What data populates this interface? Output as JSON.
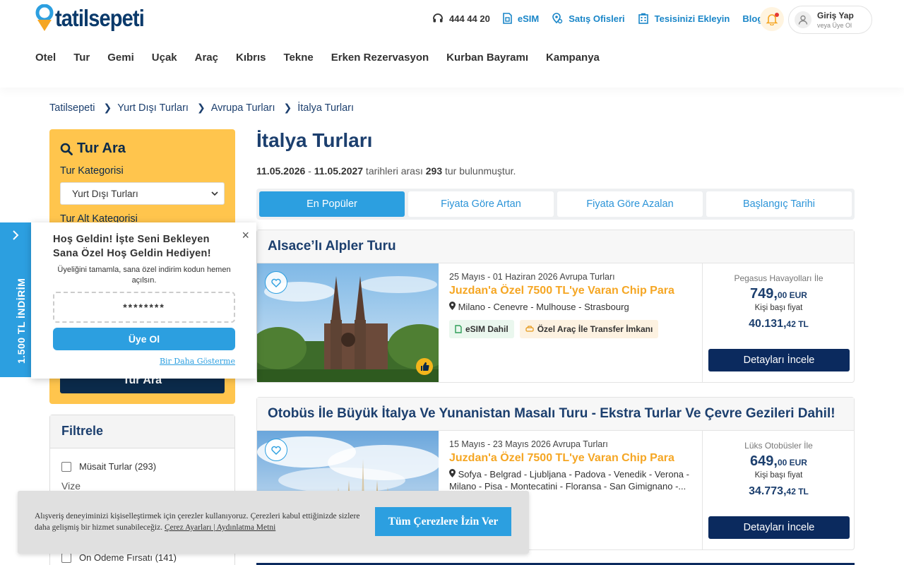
{
  "brand": {
    "name": "tatilsepeti",
    "accent": "#2c9fe0",
    "navy": "#0b2a5e",
    "orange": "#f5a623"
  },
  "header": {
    "phone": "444 44 20",
    "esim": "eSIM",
    "offices": "Satış Ofisleri",
    "add_property": "Tesisinizi Ekleyin",
    "blog": "Blog",
    "login_main": "Giriş Yap",
    "login_sub": "veya Üye Ol"
  },
  "nav": [
    "Otel",
    "Tur",
    "Gemi",
    "Uçak",
    "Araç",
    "Kıbrıs",
    "Tekne",
    "Erken Rezervasyon",
    "Kurban Bayramı",
    "Kampanya"
  ],
  "breadcrumb": [
    "Tatilsepeti",
    "Yurt Dışı Turları",
    "Avrupa Turları",
    "İtalya Turları"
  ],
  "search": {
    "title": "Tur Ara",
    "category_label": "Tur Kategorisi",
    "category_value": "Yurt Dışı Turları",
    "subcategory_label": "Tur Alt Kategorisi",
    "button": "Tur Ara"
  },
  "filter": {
    "title": "Filtrele",
    "available": "Müsait Turlar (293)",
    "visa_label": "Vize",
    "prepay": "Ön Ödeme Fırsatı (141)"
  },
  "main": {
    "title": "İtalya Turları",
    "date_from": "11.05.2026",
    "date_to": "11.05.2027",
    "date_sep": " - ",
    "range_text": " tarihleri arası ",
    "count": "293",
    "count_text": " tur bulunmuştur."
  },
  "sort_tabs": [
    "En Popüler",
    "Fiyata Göre Artan",
    "Fiyata Göre Azalan",
    "Başlangıç Tarihi"
  ],
  "tours": [
    {
      "title": "Alsace’lı Alpler Turu",
      "date": "25 Mayıs - 01 Haziran 2026 Avrupa Turları",
      "promo": "Juzdan'a Özel 7500 TL'ye Varan Chip Para",
      "route": "Milano - Cenevre - Mulhouse - Strasbourg",
      "tag1": "eSIM Dahil",
      "tag2": "Özel Araç İle Transfer İmkanı",
      "carrier": "Pegasus Havayolları İle",
      "price_eur_int": "749,",
      "price_eur_dec": "00 EUR",
      "per_person": "Kişi başı fiyat",
      "price_tl_int": "40.131,",
      "price_tl_dec": "42 TL",
      "button": "Detayları İncele"
    },
    {
      "title": "Otobüs İle Büyük İtalya Ve Yunanistan Masalı Turu - Ekstra Turlar Ve Çevre Gezileri Dahil!",
      "date": "15 Mayıs - 23 Mayıs 2026 Avrupa Turları",
      "promo": "Juzdan'a Özel 7500 TL'ye Varan Chip Para",
      "route": "Sofya - Belgrad - Ljubljana - Padova - Venedik - Verona - Milano - Pisa - Montecatini - Floransa - San Gimignano -...",
      "carrier": "Lüks Otobüsler İle",
      "price_eur_int": "649,",
      "price_eur_dec": "00 EUR",
      "per_person": "Kişi başı fiyat",
      "price_tl_int": "34.773,",
      "price_tl_dec": "42 TL",
      "button": "Detayları İncele"
    }
  ],
  "side_tab": {
    "text": "1.500 TL İNDİRİM"
  },
  "popup": {
    "title": "Hoş Geldin! İşte Seni Bekleyen Sana Özel Hoş Geldin Hediyen!",
    "text": "Üyeliğini tamamla, sana özel indirim kodun hemen açılsın.",
    "code": "********",
    "button": "Üye Ol",
    "dismiss": "Bir Daha Gösterme",
    "close": "×"
  },
  "cookie": {
    "text": "Alışveriş deneyiminizi kişiselleştirmek için çerezler kullanıyoruz. Çerezleri kabul ettiğinizde sizlere daha gelişmiş bir hizmet sunabileceğiz. ",
    "link": "Çerez Ayarları | Aydınlatma Metni",
    "button": "Tüm Çerezlere İzin Ver"
  }
}
